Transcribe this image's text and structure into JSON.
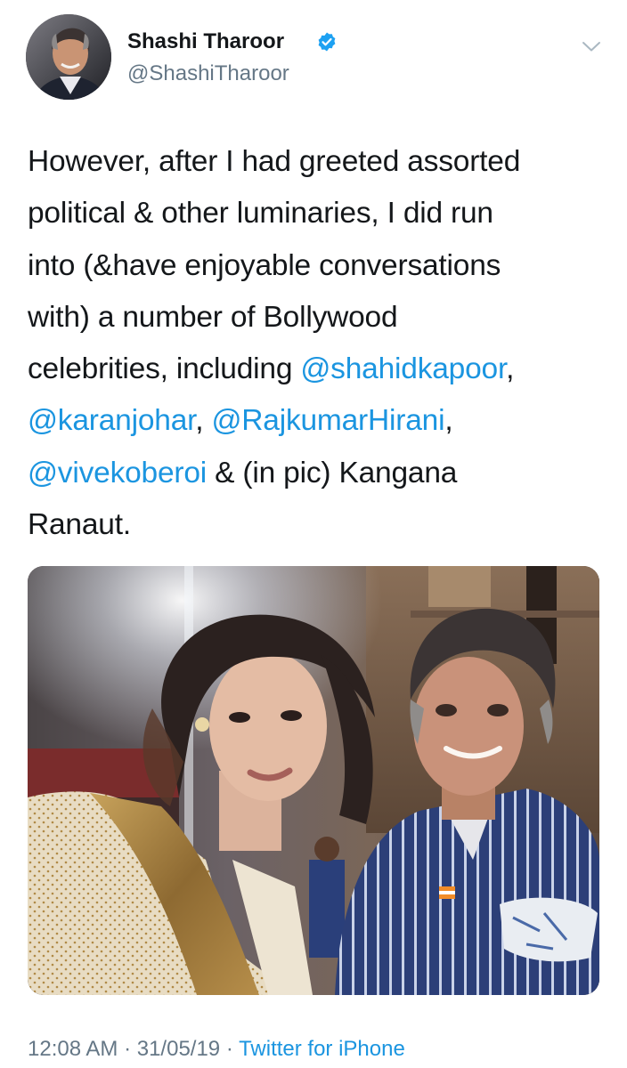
{
  "author": {
    "name": "Shashi Tharoor",
    "handle": "@ShashiTharoor",
    "verified": true
  },
  "icons": {
    "verified": "verified-badge-icon",
    "menu": "chevron-down-icon"
  },
  "tweet": {
    "line1": "However, after I had greeted assorted",
    "line2": "political & other luminaries, I did run",
    "line3": "into (&have enjoyable conversations",
    "line4": "with) a number of Bollywood",
    "line5_text": "celebrities, including ",
    "mention1": "@shahidkapoor",
    "line5_tail": ",",
    "mention2": "@karanjohar",
    "sep1": ", ",
    "mention3": "@RajkumarHirani",
    "sep2": ",",
    "mention4": "@vivekoberoi",
    "line7_tail": " & (in pic) Kangana",
    "line8": "Ranaut."
  },
  "meta": {
    "time": "12:08 AM",
    "dot1": " · ",
    "date": "31/05/19",
    "dot2": " · ",
    "source": "Twitter for iPhone"
  },
  "colors": {
    "link": "#1b95e0",
    "secondary": "#657786",
    "text": "#14171a",
    "verified": "#1da1f2"
  }
}
